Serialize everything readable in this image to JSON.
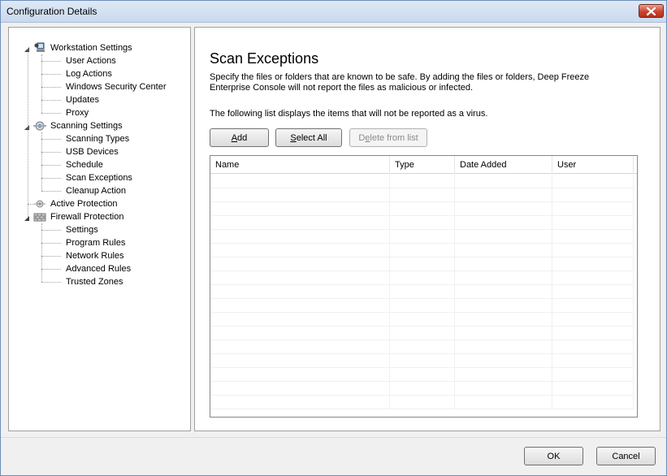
{
  "window": {
    "title": "Configuration Details"
  },
  "tree": {
    "groups": [
      {
        "label": "Workstation Settings",
        "icon": "workstation-icon",
        "children": [
          "User Actions",
          "Log Actions",
          "Windows Security Center",
          "Updates",
          "Proxy"
        ]
      },
      {
        "label": "Scanning Settings",
        "icon": "scanning-icon",
        "children": [
          "Scanning Types",
          "USB Devices",
          "Schedule",
          "Scan Exceptions",
          "Cleanup Action"
        ]
      },
      {
        "label": "Active Protection",
        "icon": "active-protection-icon",
        "children": []
      },
      {
        "label": "Firewall Protection",
        "icon": "firewall-icon",
        "children": [
          "Settings",
          "Program Rules",
          "Network Rules",
          "Advanced Rules",
          "Trusted Zones"
        ]
      }
    ]
  },
  "main": {
    "title": "Scan Exceptions",
    "description": "Specify the files or folders that are known to be safe. By adding the files or folders, Deep Freeze Enterprise Console will not report the files as malicious or infected.",
    "list_caption": "The following list displays the items that will not be reported as a virus.",
    "buttons": {
      "add": {
        "pre": "",
        "key": "A",
        "post": "dd"
      },
      "select_all": {
        "pre": "",
        "key": "S",
        "post": "elect All"
      },
      "delete": {
        "pre": "D",
        "key": "e",
        "post": "lete from list"
      }
    },
    "table": {
      "columns": [
        "Name",
        "Type",
        "Date Added",
        "User"
      ],
      "rows": []
    }
  },
  "footer": {
    "ok": "OK",
    "cancel": "Cancel"
  }
}
